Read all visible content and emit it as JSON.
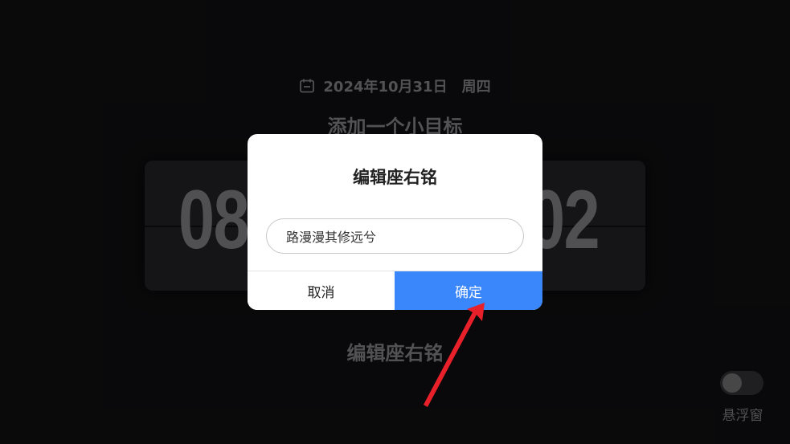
{
  "header": {
    "date": "2024年10月31日",
    "weekday": "周四",
    "calendar_icon": "calendar-icon"
  },
  "goal": {
    "title": "添加一个小目标"
  },
  "clock": {
    "left_digits": "08",
    "right_digits": "02"
  },
  "motto": {
    "label": "编辑座右铭"
  },
  "float_window": {
    "label": "悬浮窗",
    "enabled": false
  },
  "dialog": {
    "title": "编辑座右铭",
    "input_value": "路漫漫其修远兮",
    "cancel_label": "取消",
    "confirm_label": "确定",
    "confirm_color": "#3a86fb"
  },
  "annotation": {
    "arrow_color": "#e8202a"
  }
}
